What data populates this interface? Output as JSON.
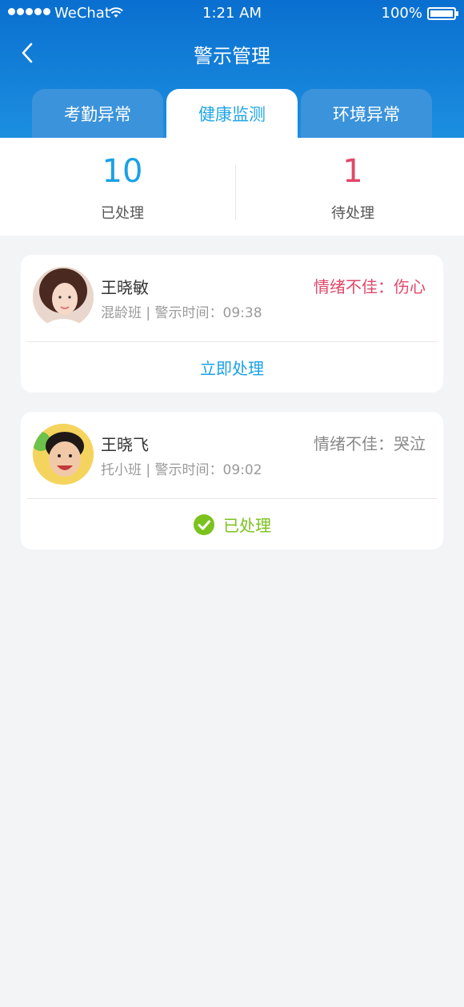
{
  "status_bar": {
    "carrier": "WeChat",
    "time": "1:21 AM",
    "battery": "100%"
  },
  "nav": {
    "title": "警示管理",
    "back_icon": "chevron-left-icon"
  },
  "tabs": [
    {
      "label": "考勤异常",
      "active": false
    },
    {
      "label": "健康监测",
      "active": true
    },
    {
      "label": "环境异常",
      "active": false
    }
  ],
  "summary": {
    "processed_count": "10",
    "processed_label": "已处理",
    "pending_count": "1",
    "pending_label": "待处理"
  },
  "alerts": [
    {
      "name": "王晓敏",
      "meta": "混龄班 | 警示时间：09:38",
      "status": "情绪不佳：伤心",
      "status_color": "#e0486a",
      "action": "立即处理",
      "action_color": "#1aa1e6"
    },
    {
      "name": "王晓飞",
      "meta": "托小班 | 警示时间：09:02",
      "status": "情绪不佳：哭泣",
      "status_color": "#888888",
      "action": "已处理",
      "action_color": "#7bc21e"
    }
  ],
  "colors": {
    "header_top": "#0a6fd0",
    "header_bottom": "#1c8fe0",
    "accent": "#1aa1e6",
    "pending": "#e0486a",
    "done": "#7bc21e"
  }
}
